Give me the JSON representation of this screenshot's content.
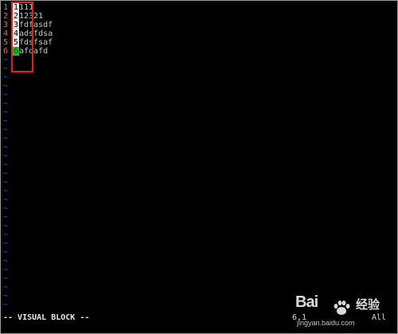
{
  "editor": {
    "lines": [
      {
        "num": "1",
        "col1": "1",
        "rest": "111"
      },
      {
        "num": "2",
        "col1": "2",
        "rest": "12321"
      },
      {
        "num": "3",
        "col1": "3",
        "rest": "fdfasdf"
      },
      {
        "num": "4",
        "col1": "4",
        "rest": "adsfdsa"
      },
      {
        "num": "5",
        "col1": "5",
        "rest": "fdsfsaf"
      },
      {
        "num": "6",
        "col1": "6",
        "rest": "afdafd"
      }
    ],
    "tilde_char": "~",
    "tilde_count": 29
  },
  "statusbar": {
    "mode": "-- VISUAL BLOCK --",
    "position": "6,1",
    "scroll": "All"
  },
  "watermark": {
    "brand": "Bai",
    "brand_cn": "经验",
    "url": "jingyan.baidu.com"
  },
  "colors": {
    "line_number": "#d2802a",
    "tilde": "#2a5cff",
    "selection": "#e8e8e8",
    "cursor": "#12c80f",
    "highlight_box": "#e0211f"
  }
}
